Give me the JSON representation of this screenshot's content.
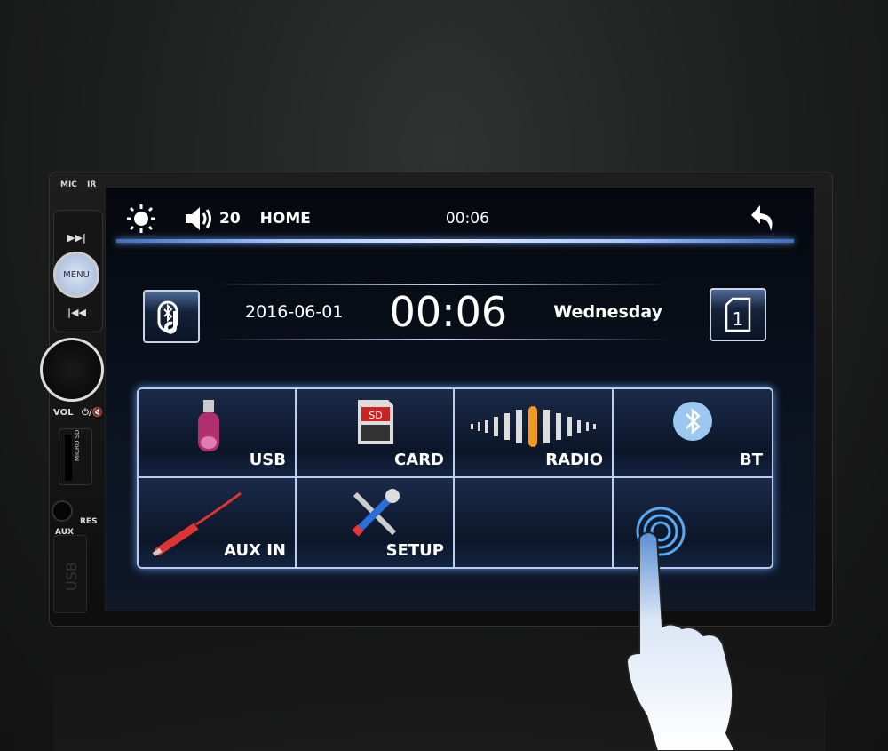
{
  "device": {
    "mic_label": "MIC",
    "ir_label": "IR",
    "menu_label": "MENU",
    "vol_label": "VOL",
    "power_mute_label": "⏻/🔇",
    "sd_label": "MICRO SD",
    "aux_label": "AUX",
    "res_label": "RES",
    "usb_label": "USB"
  },
  "topbar": {
    "volume": "20",
    "mode": "HOME",
    "time": "00:06",
    "icons": [
      "brightness-icon",
      "volume-icon",
      "back-icon"
    ]
  },
  "clock": {
    "date": "2016-06-01",
    "time": "00:06",
    "weekday": "Wednesday"
  },
  "side_buttons": {
    "left": "bluetooth-music-icon",
    "right_number": "1"
  },
  "tiles": [
    {
      "label": "USB",
      "icon": "usb-drive-icon"
    },
    {
      "label": "CARD",
      "icon": "sd-card-icon"
    },
    {
      "label": "RADIO",
      "icon": "radio-wave-icon"
    },
    {
      "label": "BT",
      "icon": "bluetooth-icon"
    },
    {
      "label": "AUX IN",
      "icon": "aux-cable-icon"
    },
    {
      "label": "SETUP",
      "icon": "tools-icon"
    },
    {
      "label": "",
      "icon": ""
    },
    {
      "label": "",
      "icon": "touch-icon"
    }
  ],
  "colors": {
    "accent": "#b9cdf0",
    "glow": "#6da0ff"
  }
}
